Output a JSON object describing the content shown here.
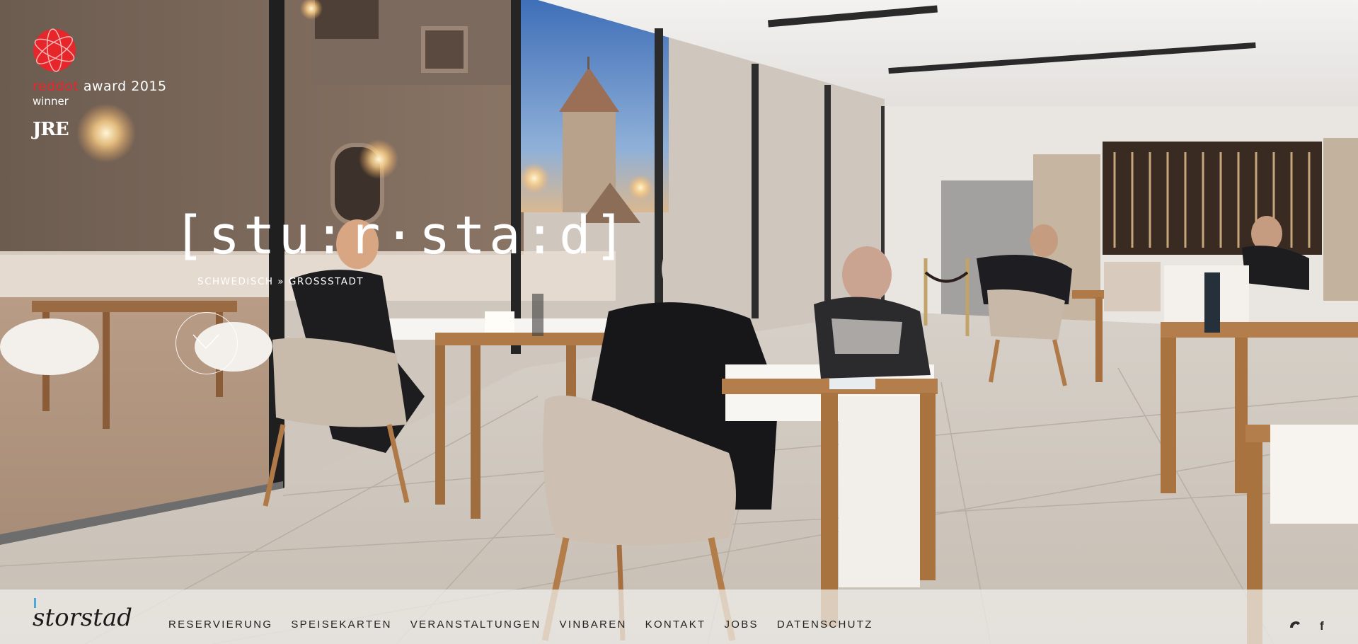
{
  "badges": {
    "reddot_red": "reddot",
    "reddot_rest": " award 2015",
    "reddot_winner": "winner",
    "jre": "JRE"
  },
  "brand": {
    "wordmark": "[stu:r·sta:d]",
    "tagline": "SCHWEDISCH » GROSSSTADT"
  },
  "footer": {
    "logo_text": "storstad",
    "nav": [
      {
        "label": "RESERVIERUNG"
      },
      {
        "label": "SPEISEKARTEN"
      },
      {
        "label": "VERANSTALTUNGEN"
      },
      {
        "label": "VINBAREN"
      },
      {
        "label": "KONTAKT"
      },
      {
        "label": "JOBS"
      },
      {
        "label": "DATENSCHUTZ"
      }
    ],
    "social": {
      "phone_icon": "phone-icon",
      "facebook_icon": "f"
    }
  },
  "colors": {
    "reddot_red": "#e7262b",
    "footer_bg": "#f0eeec",
    "nav_text": "#222222",
    "accent_blue": "#4fa7d9"
  }
}
